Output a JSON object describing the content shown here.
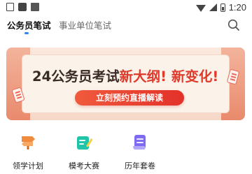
{
  "status_bar": {
    "left_icons": [
      "image-icon",
      "sim-icon",
      "font-icon"
    ],
    "right_icons": [
      "wifi-icon",
      "signal-icon",
      "battery-icon"
    ],
    "time": "1:20"
  },
  "tabs": [
    {
      "label": "公务员笔试",
      "active": true
    },
    {
      "label": "事业单位笔试",
      "active": false
    }
  ],
  "search": {
    "icon": "search-icon"
  },
  "banner": {
    "headline_part1": "24公务员考试",
    "headline_part2": "新大纲! 新变化!",
    "cta": "立刻预约直播解读"
  },
  "shortcuts": [
    {
      "label": "领学计划",
      "icon": "signpost-icon",
      "color": "#f08a3c"
    },
    {
      "label": "模考大赛",
      "icon": "pencil-paper-icon",
      "color": "#21c4a8"
    },
    {
      "label": "历年套卷",
      "icon": "scroll-icon",
      "color": "#7e6af0"
    }
  ],
  "colors": {
    "accent": "#2f86f6",
    "banner_red": "#e03a2c",
    "cta_red": "#e3312a"
  }
}
